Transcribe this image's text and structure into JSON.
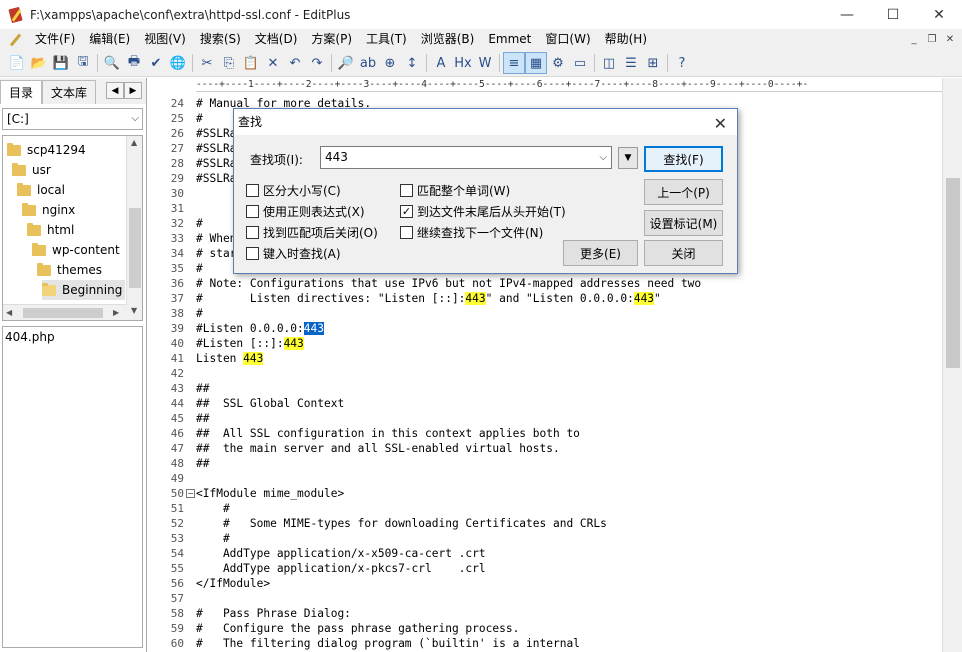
{
  "window": {
    "title": "F:\\xampps\\apache\\conf\\extra\\httpd-ssl.conf - EditPlus",
    "minimize": "—",
    "maximize": "☐",
    "close": "✕"
  },
  "menu": [
    "文件(F)",
    "编辑(E)",
    "视图(V)",
    "搜索(S)",
    "文档(D)",
    "方案(P)",
    "工具(T)",
    "浏览器(B)",
    "Emmet",
    "窗口(W)",
    "帮助(H)"
  ],
  "mdi": {
    "minimize": "_",
    "restore": "❐",
    "close": "✕"
  },
  "toolbar": {
    "icons": [
      "new-file-icon",
      "open-folder-icon",
      "save-icon",
      "save-all-icon",
      "print-preview-icon",
      "print-icon",
      "spellcheck-icon",
      "browser-icon",
      "cut-icon",
      "copy-icon",
      "paste-icon",
      "delete-icon",
      "undo-icon",
      "redo-icon",
      "find-icon",
      "replace-icon",
      "find-in-files-icon",
      "goto-line-icon",
      "font-icon",
      "hex-icon",
      "word-wrap-icon",
      "line-number-icon",
      "column-ruler-icon",
      "settings-icon",
      "fullscreen-icon",
      "split-icon",
      "clip-text-icon",
      "directory-icon",
      "help-icon"
    ],
    "glyphs": [
      "📄",
      "📂",
      "💾",
      "🖫",
      "🔍",
      "🖶",
      "✔",
      "🌐",
      "✂",
      "⎘",
      "📋",
      "✕",
      "↶",
      "↷",
      "🔎",
      "ab",
      "⊕",
      "↕",
      "A",
      "Hx",
      "W",
      "≡",
      "▦",
      "⚙",
      "▭",
      "◫",
      "☰",
      "⊞",
      "?"
    ]
  },
  "left_panel": {
    "tabs": [
      "目录",
      "文本库"
    ],
    "drive": "[C:]",
    "tree": [
      {
        "label": "scp41294",
        "indent": 0,
        "open": false
      },
      {
        "label": "usr",
        "indent": 1,
        "open": false
      },
      {
        "label": "local",
        "indent": 2,
        "open": false
      },
      {
        "label": "nginx",
        "indent": 3,
        "open": false
      },
      {
        "label": "html",
        "indent": 4,
        "open": false
      },
      {
        "label": "wp-content",
        "indent": 5,
        "open": false
      },
      {
        "label": "themes",
        "indent": 6,
        "open": false
      },
      {
        "label": "Beginning",
        "indent": 7,
        "open": true,
        "selected": true
      }
    ],
    "files": [
      "404.php"
    ]
  },
  "editor": {
    "ruler": "----+----1----+----2----+----3----+----4----+----5----+----6----+----7----+----8----+----9----+----0----+-",
    "lines": [
      {
        "n": 24,
        "t": "# Manual for more details."
      },
      {
        "n": 25,
        "t": "#"
      },
      {
        "n": 26,
        "t": "#SSLRa"
      },
      {
        "n": 27,
        "t": "#SSLRa"
      },
      {
        "n": 28,
        "t": "#SSLRa"
      },
      {
        "n": 29,
        "t": "#SSLRa"
      },
      {
        "n": 30,
        "t": ""
      },
      {
        "n": 31,
        "t": ""
      },
      {
        "n": 32,
        "t": "#"
      },
      {
        "n": 33,
        "t": "# When"
      },
      {
        "n": 34,
        "t": "# star"
      },
      {
        "n": 35,
        "t": "#"
      },
      {
        "n": 36,
        "t": "# Note: Configurations that use IPv6 but not IPv4-mapped addresses need two"
      },
      {
        "n": 37,
        "t": "#       Listen directives: \"Listen [::]:",
        "hl": "443",
        "t2": "\" and \"Listen 0.0.0.0:",
        "hl2": "443",
        "t3": "\""
      },
      {
        "n": 38,
        "t": "#"
      },
      {
        "n": 39,
        "t": "#Listen 0.0.0.0:",
        "sel": "443"
      },
      {
        "n": 40,
        "t": "#Listen [::]:",
        "hl": "443"
      },
      {
        "n": 41,
        "t": "Listen ",
        "hl": "443"
      },
      {
        "n": 42,
        "t": ""
      },
      {
        "n": 43,
        "t": "##"
      },
      {
        "n": 44,
        "t": "##  SSL Global Context"
      },
      {
        "n": 45,
        "t": "##"
      },
      {
        "n": 46,
        "t": "##  All SSL configuration in this context applies both to"
      },
      {
        "n": 47,
        "t": "##  the main server and all SSL-enabled virtual hosts."
      },
      {
        "n": 48,
        "t": "##"
      },
      {
        "n": 49,
        "t": ""
      },
      {
        "n": 50,
        "t": "<IfModule mime_module>",
        "fold": true
      },
      {
        "n": 51,
        "t": "    #"
      },
      {
        "n": 52,
        "t": "    #   Some MIME-types for downloading Certificates and CRLs"
      },
      {
        "n": 53,
        "t": "    #"
      },
      {
        "n": 54,
        "t": "    AddType application/x-x509-ca-cert .crt"
      },
      {
        "n": 55,
        "t": "    AddType application/x-pkcs7-crl    .crl"
      },
      {
        "n": 56,
        "t": "</IfModule>"
      },
      {
        "n": 57,
        "t": ""
      },
      {
        "n": 58,
        "t": "#   Pass Phrase Dialog:"
      },
      {
        "n": 59,
        "t": "#   Configure the pass phrase gathering process."
      },
      {
        "n": 60,
        "t": "#   The filtering dialog program (`builtin' is a internal"
      }
    ]
  },
  "find_dialog": {
    "title": "查找",
    "close": "✕",
    "find_label": "查找项(I):",
    "find_value": "443",
    "history_arrow": "▼",
    "options": [
      {
        "label": "区分大小写(C)",
        "checked": false
      },
      {
        "label": "匹配整个单词(W)",
        "checked": false
      },
      {
        "label": "使用正则表达式(X)",
        "checked": false
      },
      {
        "label": "到达文件末尾后从头开始(T)",
        "checked": true
      },
      {
        "label": "找到匹配项后关闭(O)",
        "checked": false
      },
      {
        "label": "继续查找下一个文件(N)",
        "checked": false
      },
      {
        "label": "键入时查找(A)",
        "checked": false
      }
    ],
    "buttons": {
      "find": "查找(F)",
      "prev": "上一个(P)",
      "mark": "设置标记(M)",
      "more": "更多(E)",
      "close": "关闭"
    }
  }
}
